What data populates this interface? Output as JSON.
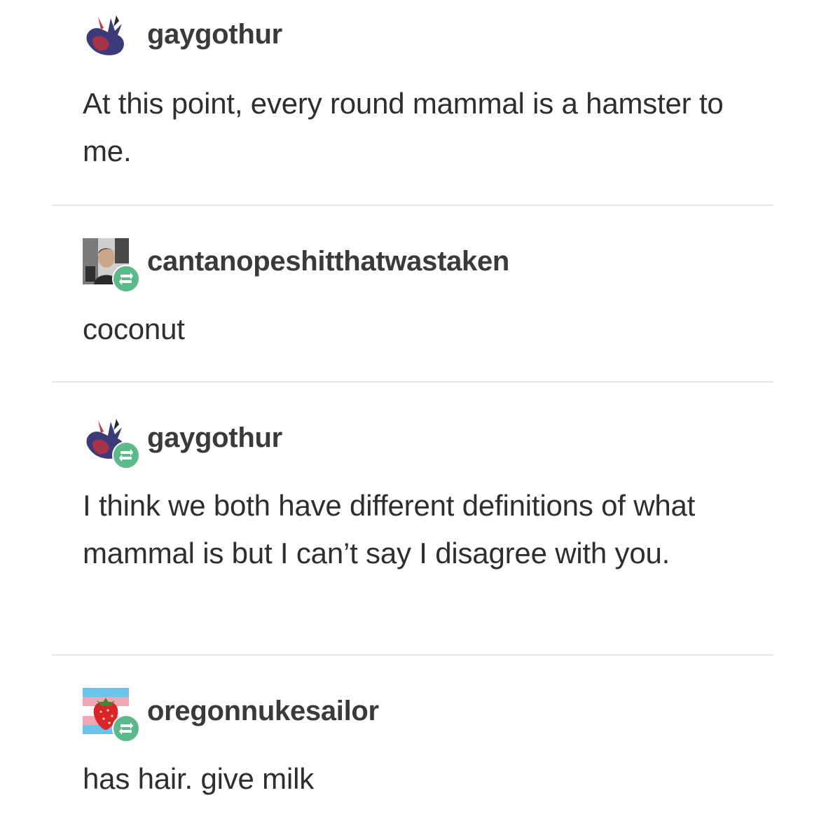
{
  "posts": [
    {
      "username": "gaygothur",
      "avatar": "spider-hand-avatar",
      "reblog": false,
      "text": "At this point, every round mammal is a hamster to me."
    },
    {
      "username": "cantanopeshitthatwastaken",
      "avatar": "person-photo-avatar",
      "reblog": true,
      "text": "coconut"
    },
    {
      "username": "gaygothur",
      "avatar": "spider-hand-avatar",
      "reblog": true,
      "text": "I think we both have different definitions of what mammal is but I can’t say I disagree with you."
    },
    {
      "username": "oregonnukesailor",
      "avatar": "strawberry-flag-avatar",
      "reblog": true,
      "text": "has hair. give milk"
    }
  ],
  "colors": {
    "reblog_badge": "#5cb98a",
    "divider": "#e6e6e6",
    "text": "#2e2e2e"
  }
}
